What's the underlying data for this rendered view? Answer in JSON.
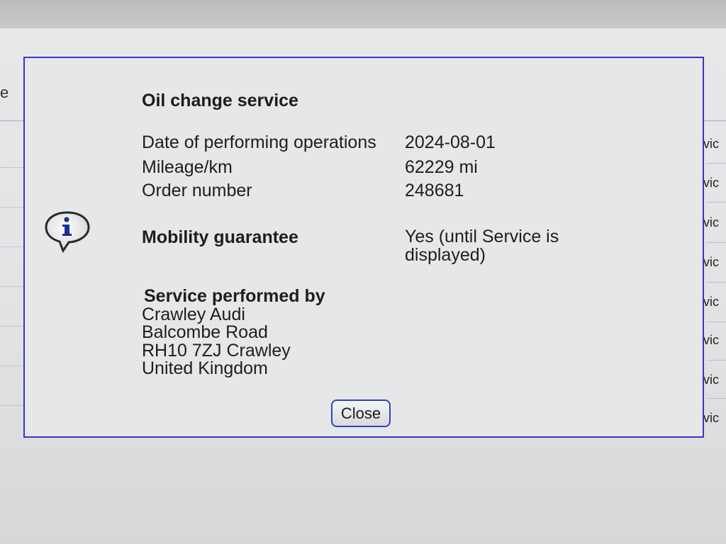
{
  "background": {
    "left_mark": "e",
    "row_stub": "vic"
  },
  "dialog": {
    "icon": "info-icon",
    "title": "Oil change service",
    "fields": [
      {
        "label": "Date of performing operations",
        "value": "2024-08-01"
      },
      {
        "label": "Mileage/km",
        "value": "62229 mi"
      },
      {
        "label": "Order number",
        "value": "248681"
      }
    ],
    "mobility": {
      "label": "Mobility guarantee",
      "value": "Yes (until Service is displayed)"
    },
    "service": {
      "heading": "Service performed by",
      "lines": [
        "Crawley Audi",
        "Balcombe Road",
        "RH10 7ZJ Crawley",
        "United Kingdom"
      ]
    },
    "close_label": "Close",
    "border_color": "#3a34c9"
  }
}
